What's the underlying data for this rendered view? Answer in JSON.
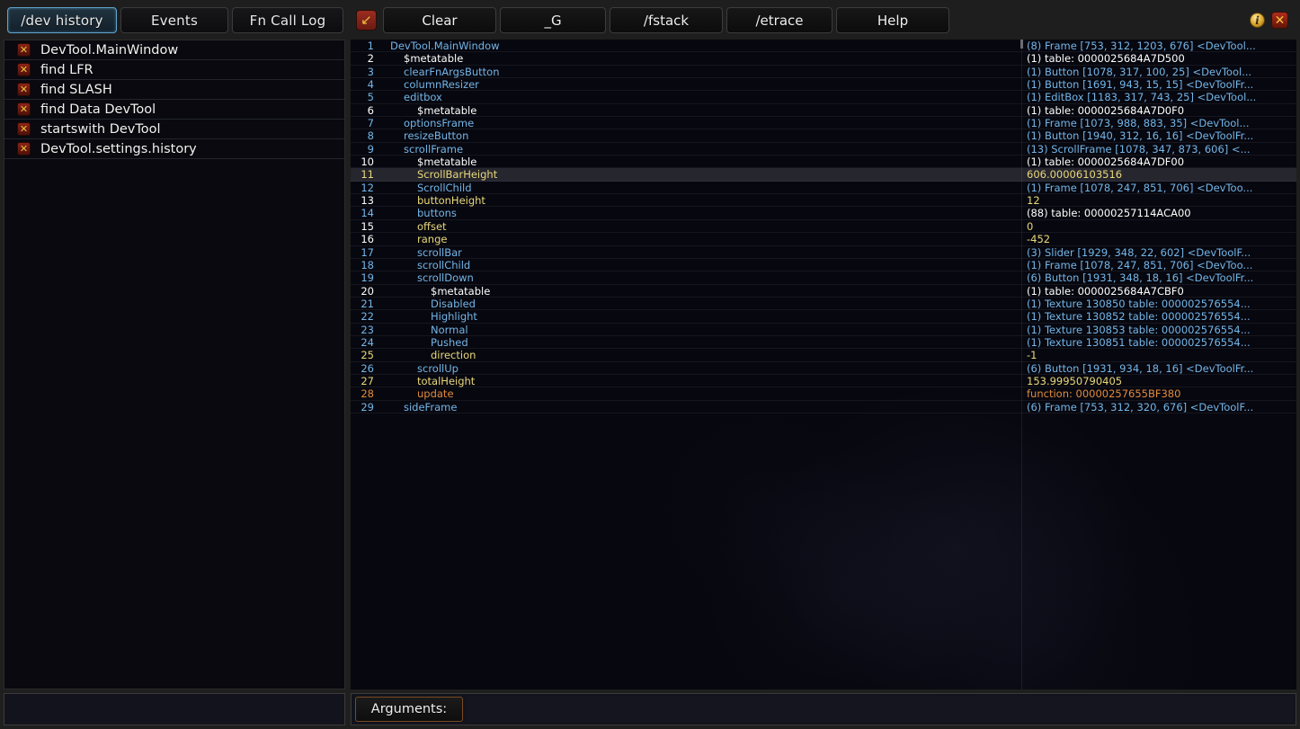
{
  "window": {
    "info_icon": "info-icon",
    "close_icon": "close-icon",
    "close_glyph": "✕",
    "info_glyph": "i"
  },
  "tabs": [
    {
      "label": "/dev history",
      "active": true
    },
    {
      "label": "Events",
      "active": false
    },
    {
      "label": "Fn Call Log",
      "active": false
    }
  ],
  "toolbar": {
    "arrow_button_glyph": "↙",
    "arrow_button_name": "collapse-arrow-button",
    "buttons": [
      {
        "label": "Clear",
        "id": "b-clear"
      },
      {
        "label": "_G",
        "id": "b-g"
      },
      {
        "label": "/fstack",
        "id": "b-fstack"
      },
      {
        "label": "/etrace",
        "id": "b-etrace"
      },
      {
        "label": "Help",
        "id": "b-help"
      }
    ]
  },
  "sidebar": {
    "delete_glyph": "✕",
    "history": [
      {
        "label": "DevTool.MainWindow"
      },
      {
        "label": "find LFR"
      },
      {
        "label": "find SLASH"
      },
      {
        "label": "find Data DevTool"
      },
      {
        "label": "startswith DevTool"
      },
      {
        "label": "DevTool.settings.history"
      }
    ],
    "input_value": "",
    "input_placeholder": ""
  },
  "bottom": {
    "arguments_label": "Arguments:",
    "arguments_value": "",
    "arguments_placeholder": ""
  },
  "tree": {
    "rows": [
      {
        "n": "1",
        "key": "DevTool.MainWindow",
        "indent": 0,
        "keyColor": "c-blue",
        "numColor": "c-blue",
        "value": "(8) Frame [753, 312, 1203, 676] <DevTool...",
        "valColor": "c-blue"
      },
      {
        "n": "2",
        "key": "$metatable",
        "indent": 1,
        "keyColor": "c-white",
        "numColor": "c-white",
        "value": "(1) table: 0000025684A7D500",
        "valColor": "c-white"
      },
      {
        "n": "3",
        "key": "clearFnArgsButton",
        "indent": 1,
        "keyColor": "c-blue",
        "numColor": "c-blue",
        "value": "(1) Button [1078, 317, 100, 25] <DevTool...",
        "valColor": "c-blue"
      },
      {
        "n": "4",
        "key": "columnResizer",
        "indent": 1,
        "keyColor": "c-blue",
        "numColor": "c-blue",
        "value": "(1) Button [1691, 943, 15, 15] <DevToolFr...",
        "valColor": "c-blue"
      },
      {
        "n": "5",
        "key": "editbox",
        "indent": 1,
        "keyColor": "c-blue",
        "numColor": "c-blue",
        "value": "(1) EditBox [1183, 317, 743, 25] <DevTool...",
        "valColor": "c-blue"
      },
      {
        "n": "6",
        "key": "$metatable",
        "indent": 2,
        "keyColor": "c-white",
        "numColor": "c-white",
        "value": "(1) table: 0000025684A7D0F0",
        "valColor": "c-white"
      },
      {
        "n": "7",
        "key": "optionsFrame",
        "indent": 1,
        "keyColor": "c-blue",
        "numColor": "c-blue",
        "value": "(1) Frame [1073, 988, 883, 35] <DevTool...",
        "valColor": "c-blue"
      },
      {
        "n": "8",
        "key": "resizeButton",
        "indent": 1,
        "keyColor": "c-blue",
        "numColor": "c-blue",
        "value": "(1) Button [1940, 312, 16, 16] <DevToolFr...",
        "valColor": "c-blue"
      },
      {
        "n": "9",
        "key": "scrollFrame",
        "indent": 1,
        "keyColor": "c-blue",
        "numColor": "c-blue",
        "value": "(13) ScrollFrame [1078, 347, 873, 606] <...",
        "valColor": "c-blue"
      },
      {
        "n": "10",
        "key": "$metatable",
        "indent": 2,
        "keyColor": "c-white",
        "numColor": "c-white",
        "value": "(1) table: 0000025684A7DF00",
        "valColor": "c-white"
      },
      {
        "n": "11",
        "key": "ScrollBarHeight",
        "indent": 2,
        "keyColor": "c-yellow",
        "numColor": "c-yellow",
        "value": "606.00006103516",
        "valColor": "c-yellow",
        "selected": true
      },
      {
        "n": "12",
        "key": "ScrollChild",
        "indent": 2,
        "keyColor": "c-blue",
        "numColor": "c-blue",
        "value": "(1) Frame [1078, 247, 851, 706] <DevToo...",
        "valColor": "c-blue"
      },
      {
        "n": "13",
        "key": "buttonHeight",
        "indent": 2,
        "keyColor": "c-yellow",
        "numColor": "c-white",
        "value": "12",
        "valColor": "c-yellow"
      },
      {
        "n": "14",
        "key": "buttons",
        "indent": 2,
        "keyColor": "c-blue",
        "numColor": "c-blue",
        "value": "(88) table: 00000257114ACA00",
        "valColor": "c-white"
      },
      {
        "n": "15",
        "key": "offset",
        "indent": 2,
        "keyColor": "c-yellow",
        "numColor": "c-white",
        "value": "0",
        "valColor": "c-yellow"
      },
      {
        "n": "16",
        "key": "range",
        "indent": 2,
        "keyColor": "c-yellow",
        "numColor": "c-white",
        "value": "-452",
        "valColor": "c-yellow"
      },
      {
        "n": "17",
        "key": "scrollBar",
        "indent": 2,
        "keyColor": "c-blue",
        "numColor": "c-blue",
        "value": "(3) Slider [1929, 348, 22, 602] <DevToolF...",
        "valColor": "c-blue"
      },
      {
        "n": "18",
        "key": "scrollChild",
        "indent": 2,
        "keyColor": "c-blue",
        "numColor": "c-blue",
        "value": "(1) Frame [1078, 247, 851, 706] <DevToo...",
        "valColor": "c-blue"
      },
      {
        "n": "19",
        "key": "scrollDown",
        "indent": 2,
        "keyColor": "c-blue",
        "numColor": "c-blue",
        "value": "(6) Button [1931, 348, 18, 16] <DevToolFr...",
        "valColor": "c-blue"
      },
      {
        "n": "20",
        "key": "$metatable",
        "indent": 3,
        "keyColor": "c-white",
        "numColor": "c-white",
        "value": "(1) table: 0000025684A7CBF0",
        "valColor": "c-white"
      },
      {
        "n": "21",
        "key": "Disabled",
        "indent": 3,
        "keyColor": "c-blue",
        "numColor": "c-blue",
        "value": "(1) Texture 130850 table: 000002576554...",
        "valColor": "c-blue"
      },
      {
        "n": "22",
        "key": "Highlight",
        "indent": 3,
        "keyColor": "c-blue",
        "numColor": "c-blue",
        "value": "(1) Texture 130852 table: 000002576554...",
        "valColor": "c-blue"
      },
      {
        "n": "23",
        "key": "Normal",
        "indent": 3,
        "keyColor": "c-blue",
        "numColor": "c-blue",
        "value": "(1) Texture 130853 table: 000002576554...",
        "valColor": "c-blue"
      },
      {
        "n": "24",
        "key": "Pushed",
        "indent": 3,
        "keyColor": "c-blue",
        "numColor": "c-blue",
        "value": "(1) Texture 130851 table: 000002576554...",
        "valColor": "c-blue"
      },
      {
        "n": "25",
        "key": "direction",
        "indent": 3,
        "keyColor": "c-yellow",
        "numColor": "c-yellow",
        "value": "-1",
        "valColor": "c-yellow"
      },
      {
        "n": "26",
        "key": "scrollUp",
        "indent": 2,
        "keyColor": "c-blue",
        "numColor": "c-blue",
        "value": "(6) Button [1931, 934, 18, 16] <DevToolFr...",
        "valColor": "c-blue"
      },
      {
        "n": "27",
        "key": "totalHeight",
        "indent": 2,
        "keyColor": "c-yellow",
        "numColor": "c-yellow",
        "value": "153.99950790405",
        "valColor": "c-yellow"
      },
      {
        "n": "28",
        "key": "update",
        "indent": 2,
        "keyColor": "c-orange",
        "numColor": "c-orange",
        "value": "function: 00000257655BF380",
        "valColor": "c-orange"
      },
      {
        "n": "29",
        "key": "sideFrame",
        "indent": 1,
        "keyColor": "c-blue",
        "numColor": "c-blue",
        "value": "(6) Frame [753, 312, 320, 676] <DevToolF...",
        "valColor": "c-blue"
      }
    ]
  }
}
